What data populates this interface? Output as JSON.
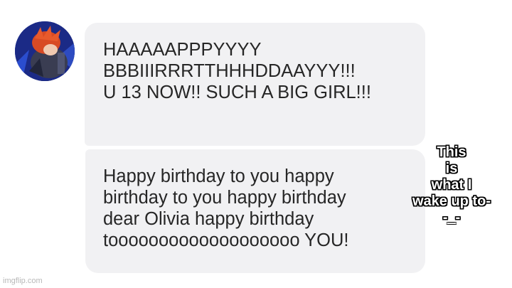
{
  "conversation": {
    "messages": [
      {
        "lines": [
          "HAAAAAPPPYYYY",
          "BBBIIIRRRTTHHHDDAAYYY!!!",
          "U 13 NOW!! SUCH A BIG GIRL!!!"
        ]
      },
      {
        "lines": [
          "Happy birthday to you happy",
          "birthday to you happy birthday",
          "dear Olivia happy birthday",
          "tooooooooooooooooooo YOU!"
        ]
      }
    ]
  },
  "meme_caption": {
    "lines": [
      "This",
      "is",
      "what I",
      "wake up to-",
      "-_-"
    ]
  },
  "watermark": "imgflip.com",
  "colors": {
    "bubble_bg": "#f1f1f3",
    "bubble_text": "#262626",
    "page_bg": "#ffffff"
  },
  "icons": {
    "avatar": "profile-avatar"
  }
}
